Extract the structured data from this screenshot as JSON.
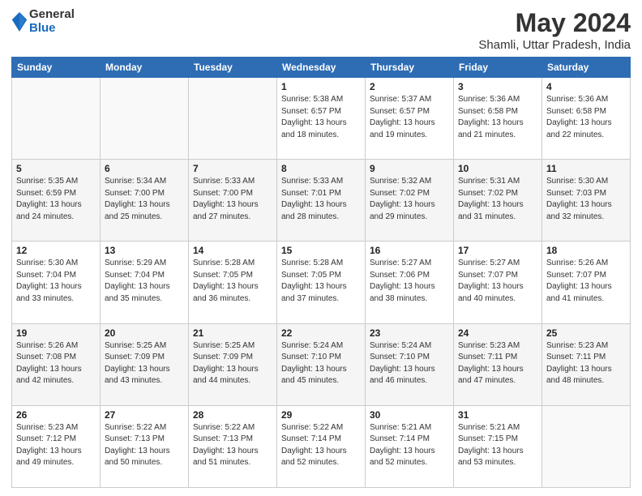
{
  "logo": {
    "general": "General",
    "blue": "Blue"
  },
  "title": "May 2024",
  "subtitle": "Shamli, Uttar Pradesh, India",
  "days_of_week": [
    "Sunday",
    "Monday",
    "Tuesday",
    "Wednesday",
    "Thursday",
    "Friday",
    "Saturday"
  ],
  "weeks": [
    [
      {
        "day": "",
        "info": ""
      },
      {
        "day": "",
        "info": ""
      },
      {
        "day": "",
        "info": ""
      },
      {
        "day": "1",
        "info": "Sunrise: 5:38 AM\nSunset: 6:57 PM\nDaylight: 13 hours and 18 minutes."
      },
      {
        "day": "2",
        "info": "Sunrise: 5:37 AM\nSunset: 6:57 PM\nDaylight: 13 hours and 19 minutes."
      },
      {
        "day": "3",
        "info": "Sunrise: 5:36 AM\nSunset: 6:58 PM\nDaylight: 13 hours and 21 minutes."
      },
      {
        "day": "4",
        "info": "Sunrise: 5:36 AM\nSunset: 6:58 PM\nDaylight: 13 hours and 22 minutes."
      }
    ],
    [
      {
        "day": "5",
        "info": "Sunrise: 5:35 AM\nSunset: 6:59 PM\nDaylight: 13 hours and 24 minutes."
      },
      {
        "day": "6",
        "info": "Sunrise: 5:34 AM\nSunset: 7:00 PM\nDaylight: 13 hours and 25 minutes."
      },
      {
        "day": "7",
        "info": "Sunrise: 5:33 AM\nSunset: 7:00 PM\nDaylight: 13 hours and 27 minutes."
      },
      {
        "day": "8",
        "info": "Sunrise: 5:33 AM\nSunset: 7:01 PM\nDaylight: 13 hours and 28 minutes."
      },
      {
        "day": "9",
        "info": "Sunrise: 5:32 AM\nSunset: 7:02 PM\nDaylight: 13 hours and 29 minutes."
      },
      {
        "day": "10",
        "info": "Sunrise: 5:31 AM\nSunset: 7:02 PM\nDaylight: 13 hours and 31 minutes."
      },
      {
        "day": "11",
        "info": "Sunrise: 5:30 AM\nSunset: 7:03 PM\nDaylight: 13 hours and 32 minutes."
      }
    ],
    [
      {
        "day": "12",
        "info": "Sunrise: 5:30 AM\nSunset: 7:04 PM\nDaylight: 13 hours and 33 minutes."
      },
      {
        "day": "13",
        "info": "Sunrise: 5:29 AM\nSunset: 7:04 PM\nDaylight: 13 hours and 35 minutes."
      },
      {
        "day": "14",
        "info": "Sunrise: 5:28 AM\nSunset: 7:05 PM\nDaylight: 13 hours and 36 minutes."
      },
      {
        "day": "15",
        "info": "Sunrise: 5:28 AM\nSunset: 7:05 PM\nDaylight: 13 hours and 37 minutes."
      },
      {
        "day": "16",
        "info": "Sunrise: 5:27 AM\nSunset: 7:06 PM\nDaylight: 13 hours and 38 minutes."
      },
      {
        "day": "17",
        "info": "Sunrise: 5:27 AM\nSunset: 7:07 PM\nDaylight: 13 hours and 40 minutes."
      },
      {
        "day": "18",
        "info": "Sunrise: 5:26 AM\nSunset: 7:07 PM\nDaylight: 13 hours and 41 minutes."
      }
    ],
    [
      {
        "day": "19",
        "info": "Sunrise: 5:26 AM\nSunset: 7:08 PM\nDaylight: 13 hours and 42 minutes."
      },
      {
        "day": "20",
        "info": "Sunrise: 5:25 AM\nSunset: 7:09 PM\nDaylight: 13 hours and 43 minutes."
      },
      {
        "day": "21",
        "info": "Sunrise: 5:25 AM\nSunset: 7:09 PM\nDaylight: 13 hours and 44 minutes."
      },
      {
        "day": "22",
        "info": "Sunrise: 5:24 AM\nSunset: 7:10 PM\nDaylight: 13 hours and 45 minutes."
      },
      {
        "day": "23",
        "info": "Sunrise: 5:24 AM\nSunset: 7:10 PM\nDaylight: 13 hours and 46 minutes."
      },
      {
        "day": "24",
        "info": "Sunrise: 5:23 AM\nSunset: 7:11 PM\nDaylight: 13 hours and 47 minutes."
      },
      {
        "day": "25",
        "info": "Sunrise: 5:23 AM\nSunset: 7:11 PM\nDaylight: 13 hours and 48 minutes."
      }
    ],
    [
      {
        "day": "26",
        "info": "Sunrise: 5:23 AM\nSunset: 7:12 PM\nDaylight: 13 hours and 49 minutes."
      },
      {
        "day": "27",
        "info": "Sunrise: 5:22 AM\nSunset: 7:13 PM\nDaylight: 13 hours and 50 minutes."
      },
      {
        "day": "28",
        "info": "Sunrise: 5:22 AM\nSunset: 7:13 PM\nDaylight: 13 hours and 51 minutes."
      },
      {
        "day": "29",
        "info": "Sunrise: 5:22 AM\nSunset: 7:14 PM\nDaylight: 13 hours and 52 minutes."
      },
      {
        "day": "30",
        "info": "Sunrise: 5:21 AM\nSunset: 7:14 PM\nDaylight: 13 hours and 52 minutes."
      },
      {
        "day": "31",
        "info": "Sunrise: 5:21 AM\nSunset: 7:15 PM\nDaylight: 13 hours and 53 minutes."
      },
      {
        "day": "",
        "info": ""
      }
    ]
  ]
}
